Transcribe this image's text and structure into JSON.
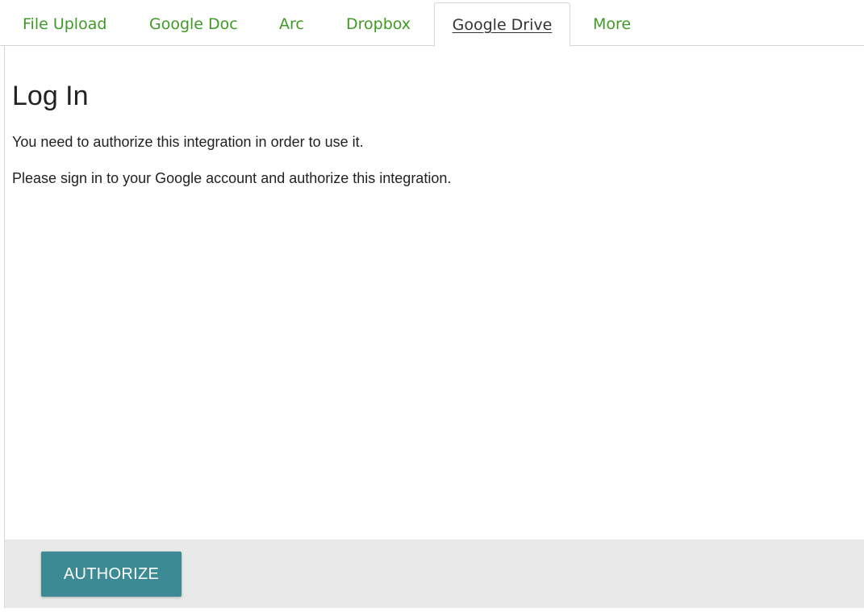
{
  "tabs": [
    {
      "label": "File Upload",
      "active": false
    },
    {
      "label": "Google Doc",
      "active": false
    },
    {
      "label": "Arc",
      "active": false
    },
    {
      "label": "Dropbox",
      "active": false
    },
    {
      "label": "Google Drive",
      "active": true
    },
    {
      "label": "More",
      "active": false
    }
  ],
  "main": {
    "title": "Log In",
    "paragraphs": [
      "You need to authorize this integration in order to use it.",
      "Please sign in to your Google account and authorize this integration."
    ]
  },
  "footer": {
    "authorize_label": "AUTHORIZE"
  },
  "colors": {
    "tab_link": "#3f9a25",
    "button_bg": "#3b8a94",
    "footer_bg": "#e9e9e9"
  }
}
